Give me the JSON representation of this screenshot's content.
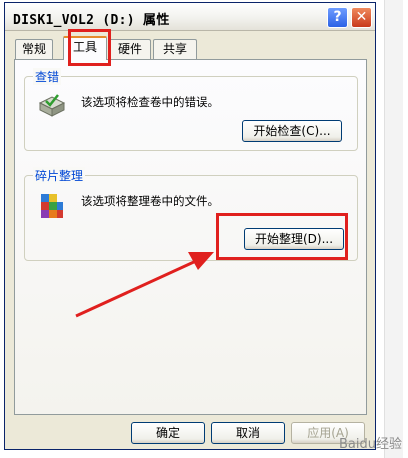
{
  "window": {
    "title": "DISK1_VOL2 (D:) 属性",
    "help_glyph": "?",
    "close_glyph": "✕"
  },
  "tabs": [
    {
      "label": "常规",
      "active": false
    },
    {
      "label": "工具",
      "active": true
    },
    {
      "label": "硬件",
      "active": false
    },
    {
      "label": "共享",
      "active": false
    }
  ],
  "error_check": {
    "group_label": "查错",
    "description": "该选项将检查卷中的错误。",
    "button_label": "开始检查(C)..."
  },
  "defrag": {
    "group_label": "碎片整理",
    "description": "该选项将整理卷中的文件。",
    "button_label": "开始整理(D)..."
  },
  "footer": {
    "ok_label": "确定",
    "cancel_label": "取消",
    "apply_label": "应用(A)"
  },
  "watermark": "Baidu经验",
  "colors": {
    "highlight_red": "#e0201e",
    "group_label_blue": "#0046d5",
    "active_tab_accent": "#e68b2c"
  }
}
